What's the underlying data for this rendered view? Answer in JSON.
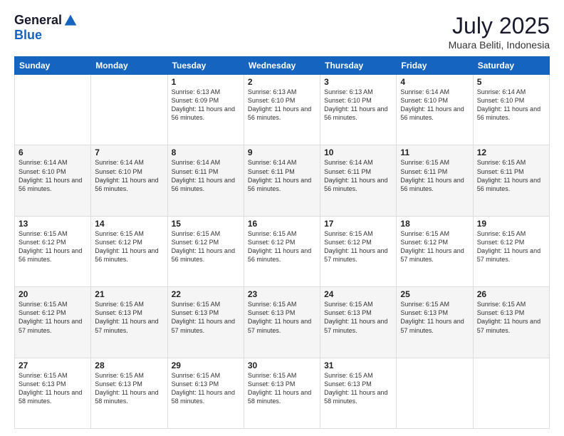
{
  "header": {
    "logo_general": "General",
    "logo_blue": "Blue",
    "month_title": "July 2025",
    "location": "Muara Beliti, Indonesia"
  },
  "days_of_week": [
    "Sunday",
    "Monday",
    "Tuesday",
    "Wednesday",
    "Thursday",
    "Friday",
    "Saturday"
  ],
  "weeks": [
    [
      {
        "day": "",
        "info": ""
      },
      {
        "day": "",
        "info": ""
      },
      {
        "day": "1",
        "info": "Sunrise: 6:13 AM\nSunset: 6:09 PM\nDaylight: 11 hours and 56 minutes."
      },
      {
        "day": "2",
        "info": "Sunrise: 6:13 AM\nSunset: 6:10 PM\nDaylight: 11 hours and 56 minutes."
      },
      {
        "day": "3",
        "info": "Sunrise: 6:13 AM\nSunset: 6:10 PM\nDaylight: 11 hours and 56 minutes."
      },
      {
        "day": "4",
        "info": "Sunrise: 6:14 AM\nSunset: 6:10 PM\nDaylight: 11 hours and 56 minutes."
      },
      {
        "day": "5",
        "info": "Sunrise: 6:14 AM\nSunset: 6:10 PM\nDaylight: 11 hours and 56 minutes."
      }
    ],
    [
      {
        "day": "6",
        "info": "Sunrise: 6:14 AM\nSunset: 6:10 PM\nDaylight: 11 hours and 56 minutes."
      },
      {
        "day": "7",
        "info": "Sunrise: 6:14 AM\nSunset: 6:10 PM\nDaylight: 11 hours and 56 minutes."
      },
      {
        "day": "8",
        "info": "Sunrise: 6:14 AM\nSunset: 6:11 PM\nDaylight: 11 hours and 56 minutes."
      },
      {
        "day": "9",
        "info": "Sunrise: 6:14 AM\nSunset: 6:11 PM\nDaylight: 11 hours and 56 minutes."
      },
      {
        "day": "10",
        "info": "Sunrise: 6:14 AM\nSunset: 6:11 PM\nDaylight: 11 hours and 56 minutes."
      },
      {
        "day": "11",
        "info": "Sunrise: 6:15 AM\nSunset: 6:11 PM\nDaylight: 11 hours and 56 minutes."
      },
      {
        "day": "12",
        "info": "Sunrise: 6:15 AM\nSunset: 6:11 PM\nDaylight: 11 hours and 56 minutes."
      }
    ],
    [
      {
        "day": "13",
        "info": "Sunrise: 6:15 AM\nSunset: 6:12 PM\nDaylight: 11 hours and 56 minutes."
      },
      {
        "day": "14",
        "info": "Sunrise: 6:15 AM\nSunset: 6:12 PM\nDaylight: 11 hours and 56 minutes."
      },
      {
        "day": "15",
        "info": "Sunrise: 6:15 AM\nSunset: 6:12 PM\nDaylight: 11 hours and 56 minutes."
      },
      {
        "day": "16",
        "info": "Sunrise: 6:15 AM\nSunset: 6:12 PM\nDaylight: 11 hours and 56 minutes."
      },
      {
        "day": "17",
        "info": "Sunrise: 6:15 AM\nSunset: 6:12 PM\nDaylight: 11 hours and 57 minutes."
      },
      {
        "day": "18",
        "info": "Sunrise: 6:15 AM\nSunset: 6:12 PM\nDaylight: 11 hours and 57 minutes."
      },
      {
        "day": "19",
        "info": "Sunrise: 6:15 AM\nSunset: 6:12 PM\nDaylight: 11 hours and 57 minutes."
      }
    ],
    [
      {
        "day": "20",
        "info": "Sunrise: 6:15 AM\nSunset: 6:12 PM\nDaylight: 11 hours and 57 minutes."
      },
      {
        "day": "21",
        "info": "Sunrise: 6:15 AM\nSunset: 6:13 PM\nDaylight: 11 hours and 57 minutes."
      },
      {
        "day": "22",
        "info": "Sunrise: 6:15 AM\nSunset: 6:13 PM\nDaylight: 11 hours and 57 minutes."
      },
      {
        "day": "23",
        "info": "Sunrise: 6:15 AM\nSunset: 6:13 PM\nDaylight: 11 hours and 57 minutes."
      },
      {
        "day": "24",
        "info": "Sunrise: 6:15 AM\nSunset: 6:13 PM\nDaylight: 11 hours and 57 minutes."
      },
      {
        "day": "25",
        "info": "Sunrise: 6:15 AM\nSunset: 6:13 PM\nDaylight: 11 hours and 57 minutes."
      },
      {
        "day": "26",
        "info": "Sunrise: 6:15 AM\nSunset: 6:13 PM\nDaylight: 11 hours and 57 minutes."
      }
    ],
    [
      {
        "day": "27",
        "info": "Sunrise: 6:15 AM\nSunset: 6:13 PM\nDaylight: 11 hours and 58 minutes."
      },
      {
        "day": "28",
        "info": "Sunrise: 6:15 AM\nSunset: 6:13 PM\nDaylight: 11 hours and 58 minutes."
      },
      {
        "day": "29",
        "info": "Sunrise: 6:15 AM\nSunset: 6:13 PM\nDaylight: 11 hours and 58 minutes."
      },
      {
        "day": "30",
        "info": "Sunrise: 6:15 AM\nSunset: 6:13 PM\nDaylight: 11 hours and 58 minutes."
      },
      {
        "day": "31",
        "info": "Sunrise: 6:15 AM\nSunset: 6:13 PM\nDaylight: 11 hours and 58 minutes."
      },
      {
        "day": "",
        "info": ""
      },
      {
        "day": "",
        "info": ""
      }
    ]
  ]
}
